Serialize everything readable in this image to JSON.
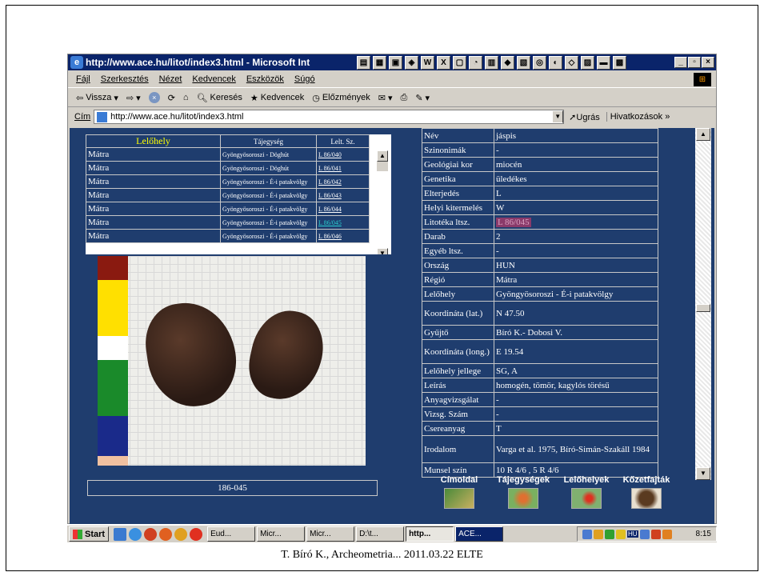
{
  "window": {
    "title": "http://www.ace.hu/litot/index3.html - Microsoft Int",
    "ie_icon": "ie-icon"
  },
  "menu": [
    "Fájl",
    "Szerkesztés",
    "Nézet",
    "Kedvencek",
    "Eszközök",
    "Súgó"
  ],
  "toolbar": {
    "back": "Vissza",
    "search": "Keresés",
    "favorites": "Kedvencek",
    "history": "Előzmények"
  },
  "address": {
    "label": "Cím",
    "url": "http://www.ace.hu/litot/index3.html",
    "go": "Ugrás",
    "links": "Hivatkozások"
  },
  "locations": {
    "headers": [
      "Lelőhely",
      "Tájegység",
      "Lelt. Sz."
    ],
    "rows": [
      {
        "region": "Mátra",
        "place": "Gyöngyösoroszi - Döghút",
        "id": "L 86/040"
      },
      {
        "region": "Mátra",
        "place": "Gyöngyösoroszi - Döghút",
        "id": "L 86/041"
      },
      {
        "region": "Mátra",
        "place": "Gyöngyösoroszi - É-i patakvölgy",
        "id": "L 86/042"
      },
      {
        "region": "Mátra",
        "place": "Gyöngyösoroszi - É-i patakvölgy",
        "id": "L 86/043"
      },
      {
        "region": "Mátra",
        "place": "Gyöngyösoroszi - É-i patakvölgy",
        "id": "L 86/044"
      },
      {
        "region": "Mátra",
        "place": "Gyöngyösoroszi - É-i patakvölgy",
        "id": "L 86/045"
      },
      {
        "region": "Mátra",
        "place": "Gyöngyösoroszi - É-i patakvölgy",
        "id": "L 86/046"
      }
    ]
  },
  "caption": "186-045",
  "properties": [
    {
      "k": "Név",
      "v": "jáspis"
    },
    {
      "k": "Szinonimák",
      "v": "-"
    },
    {
      "k": "Geológiai kor",
      "v": "miocén"
    },
    {
      "k": "Genetika",
      "v": "üledékes"
    },
    {
      "k": "Elterjedés",
      "v": "L"
    },
    {
      "k": "Helyi kitermelés",
      "v": "W"
    },
    {
      "k": "Litotéka ltsz.",
      "v": "L 86/045"
    },
    {
      "k": "Darab",
      "v": "2"
    },
    {
      "k": "Egyéb ltsz.",
      "v": "-"
    },
    {
      "k": "Ország",
      "v": "HUN"
    },
    {
      "k": "Régió",
      "v": "Mátra"
    },
    {
      "k": "Lelőhely",
      "v": "Gyöngyösoroszi - É-i patakvölgy"
    },
    {
      "k": "Koordináta (lat.)",
      "v": "N 47.50"
    },
    {
      "k": "Gyűjtő",
      "v": "Bíró K.- Dobosi V."
    },
    {
      "k": "Koordináta (long.)",
      "v": "E 19.54"
    },
    {
      "k": "Lelőhely jellege",
      "v": "SG, A"
    },
    {
      "k": "Leírás",
      "v": "homogén, tömör, kagylós törésű"
    },
    {
      "k": "Anyagvizsgálat",
      "v": "-"
    },
    {
      "k": "Vizsg. Szám",
      "v": "-"
    },
    {
      "k": "Csereanyag",
      "v": "T"
    },
    {
      "k": "Irodalom",
      "v": "Varga et al. 1975, Bíró-Simán-Szakáll 1984"
    },
    {
      "k": "Munsel szín",
      "v": "10 R 4/6 , 5 R 4/6"
    }
  ],
  "nav": [
    "Címoldal",
    "Tájegységek",
    "Lelőhelyek",
    "Kőzetfajták"
  ],
  "taskbar": {
    "start": "Start",
    "tasks": [
      "Eud...",
      "Micr...",
      "Micr...",
      "D:\\t...",
      "http...",
      "ACE..."
    ],
    "lang": "HU",
    "clock": "8:15"
  },
  "footer": "T. Bíró K., Archeometria... 2011.03.22 ELTE"
}
